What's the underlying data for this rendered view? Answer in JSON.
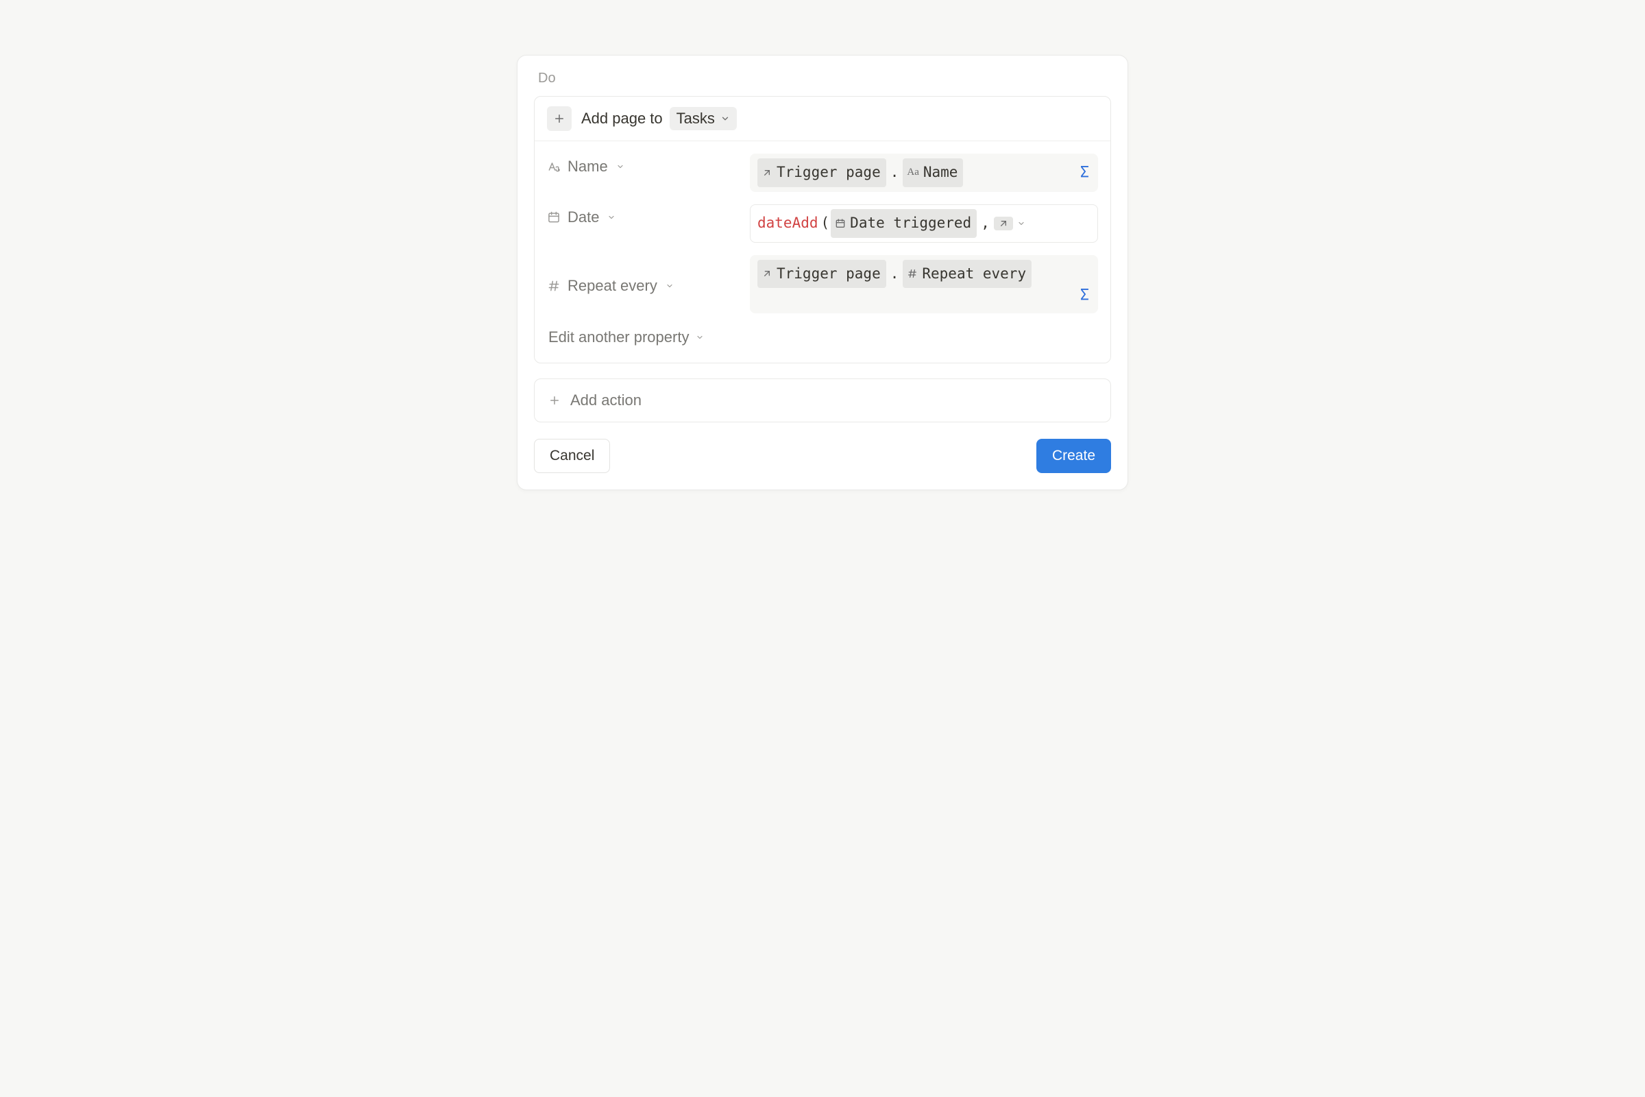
{
  "section_label": "Do",
  "action_header": {
    "prefix": "Add page to",
    "database": "Tasks"
  },
  "properties": [
    {
      "icon": "text-icon",
      "label": "Name",
      "value_kind": "readonly-formula",
      "value": {
        "tokens": [
          {
            "type": "ref",
            "icon": "arrow-up-right-icon",
            "text": "Trigger page"
          },
          {
            "type": "sep",
            "text": "."
          },
          {
            "type": "ref",
            "icon": "aa-icon",
            "text": "Name"
          }
        ]
      }
    },
    {
      "icon": "calendar-icon",
      "label": "Date",
      "value_kind": "editable-formula",
      "value": {
        "fn": "dateAdd",
        "tokens": [
          {
            "type": "fn-open"
          },
          {
            "type": "ref",
            "icon": "calendar-icon",
            "text": "Date triggered"
          },
          {
            "type": "sep",
            "text": ","
          },
          {
            "type": "ref-compact",
            "icon": "arrow-up-right-icon"
          },
          {
            "type": "chev-more"
          }
        ]
      }
    },
    {
      "icon": "hash-icon",
      "label": "Repeat every",
      "value_kind": "readonly-formula-multiline",
      "value": {
        "tokens": [
          {
            "type": "ref",
            "icon": "arrow-up-right-icon",
            "text": "Trigger page"
          },
          {
            "type": "sep",
            "text": "."
          },
          {
            "type": "ref",
            "icon": "hash-icon",
            "text": "Repeat every"
          }
        ]
      }
    }
  ],
  "edit_another": "Edit another property",
  "add_action": "Add action",
  "footer": {
    "cancel": "Cancel",
    "create": "Create"
  }
}
